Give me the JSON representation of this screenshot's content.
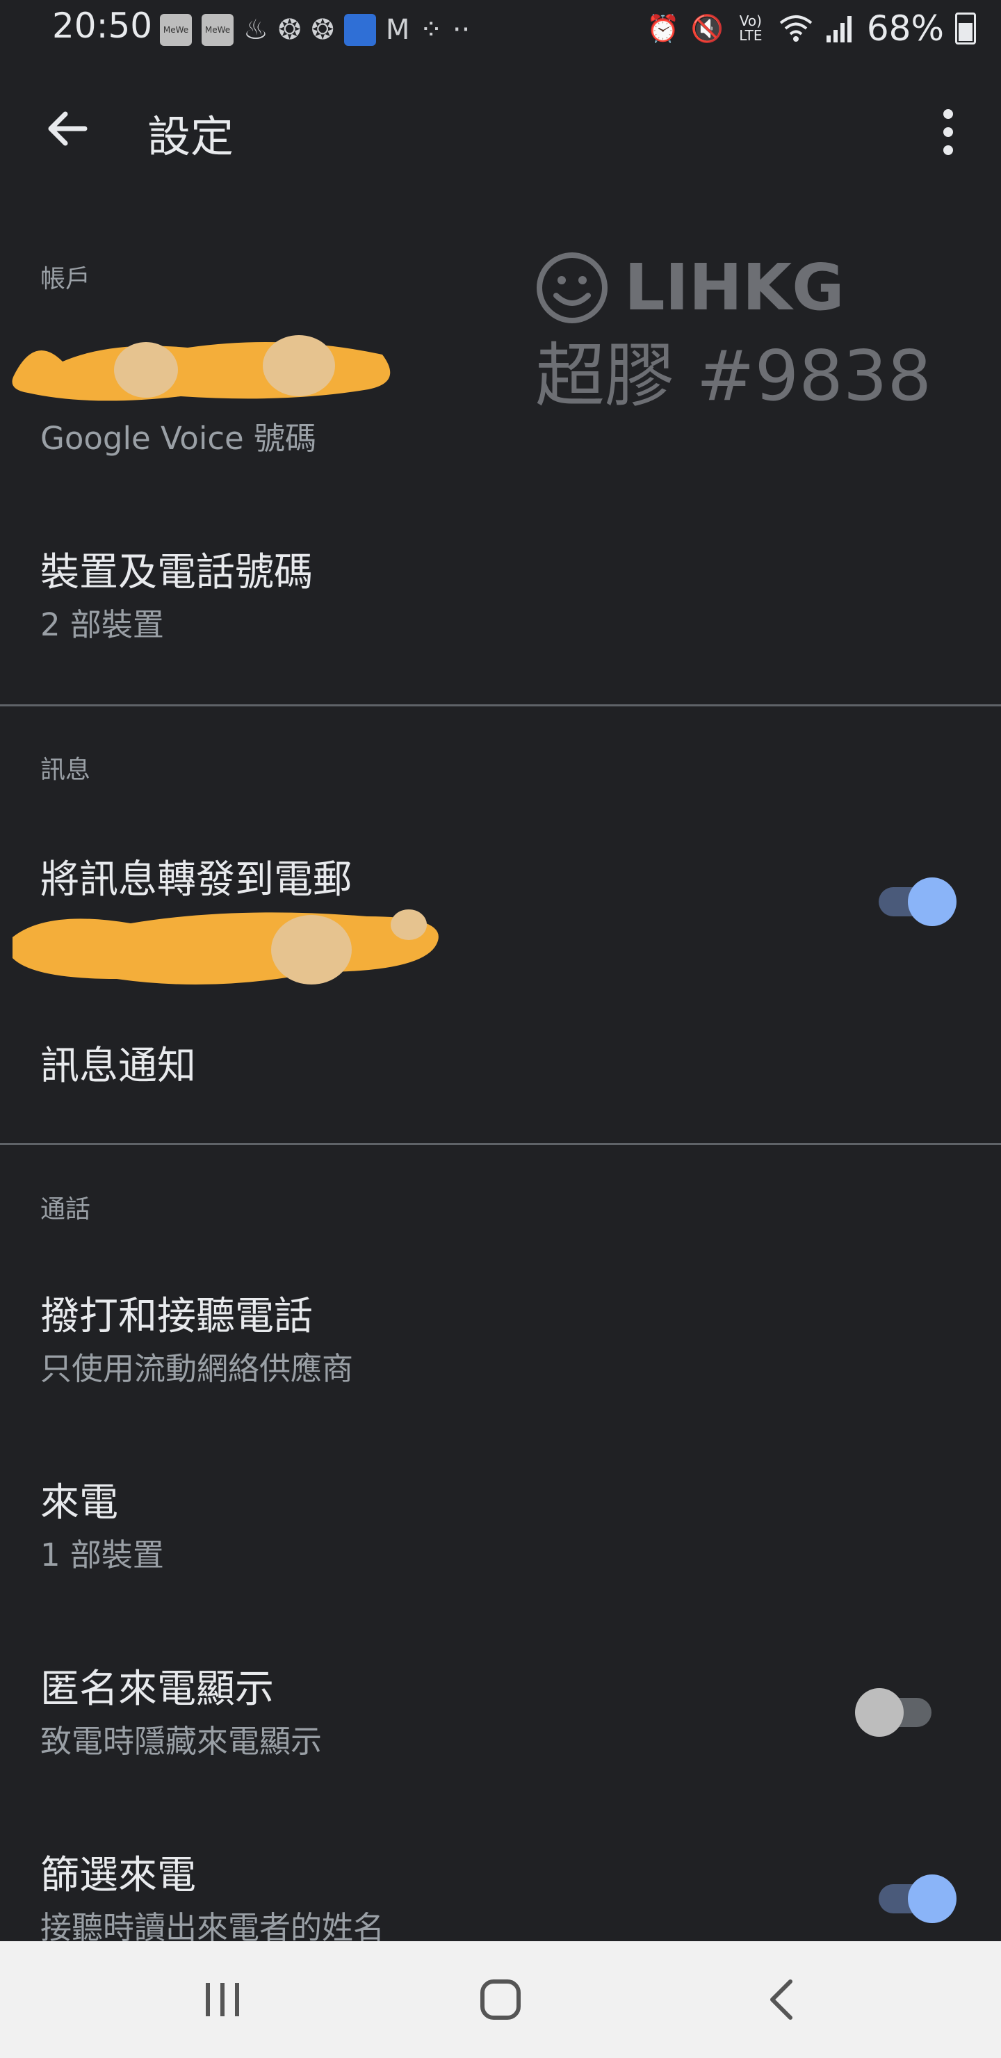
{
  "status_bar": {
    "time": "20:50",
    "left_icons": [
      "mewe-icon",
      "mewe-icon",
      "notification-icon",
      "notification-icon",
      "notification-icon",
      "card-icon",
      "gmail-icon",
      "apps-icon",
      "more-dots-icon"
    ],
    "right_icons": [
      "alarm-icon",
      "mute-icon",
      "volte-icon",
      "wifi-icon",
      "signal-icon"
    ],
    "volte_label": "Vo) LTE",
    "battery": "68%"
  },
  "app_bar": {
    "title": "設定",
    "back_icon": "arrow-back-icon",
    "more_icon": "more-vert-icon"
  },
  "sections": {
    "account": {
      "header": "帳戶",
      "voice_number_subtitle": "Google Voice 號碼",
      "devices_title": "裝置及電話號碼",
      "devices_subtitle": "2 部裝置"
    },
    "messages": {
      "header": "訊息",
      "forward_title": "將訊息轉發到電郵",
      "forward_enabled": true,
      "notifications_title": "訊息通知"
    },
    "calls": {
      "header": "通話",
      "make_receive_title": "撥打和接聽電話",
      "make_receive_subtitle": "只使用流動網絡供應商",
      "incoming_title": "來電",
      "incoming_subtitle": "1 部裝置",
      "anonymous_title": "匿名來電顯示",
      "anonymous_subtitle": "致電時隱藏來電顯示",
      "anonymous_enabled": false,
      "screen_title": "篩選來電",
      "screen_subtitle": "接聽時讀出來電者的姓名",
      "screen_enabled": true
    }
  },
  "watermark": {
    "brand": "LIHKG",
    "tag": "超膠 #9838"
  },
  "nav_bar": {
    "recents_icon": "recents-icon",
    "home_icon": "home-icon",
    "back_icon": "nav-back-icon"
  },
  "colors": {
    "background": "#202124",
    "accent": "#8ab4f8",
    "redaction": "#f4ae3a"
  }
}
